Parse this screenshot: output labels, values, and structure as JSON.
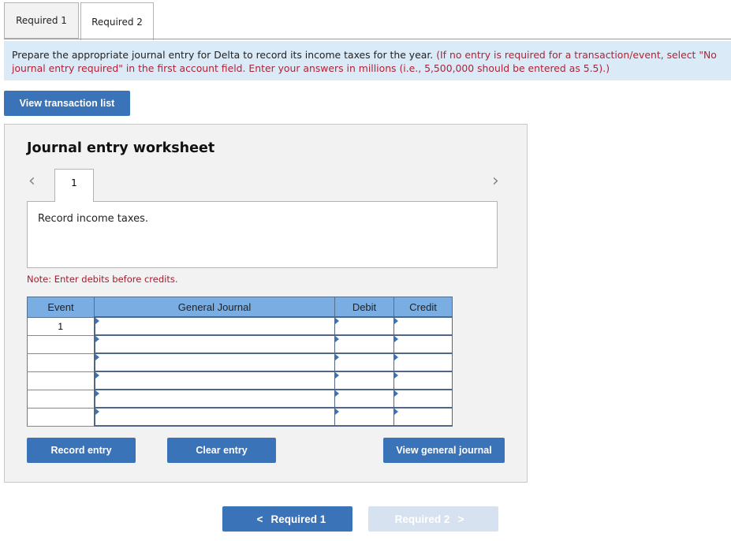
{
  "tabs": [
    {
      "label": "Required 1",
      "active": false
    },
    {
      "label": "Required 2",
      "active": true
    }
  ],
  "instructions": {
    "main": "Prepare the appropriate journal entry for Delta to record its income taxes for the year.",
    "note": "(If no entry is required for a transaction/event, select \"No journal entry required\" in the first account field. Enter your answers in millions (i.e., 5,500,000 should be entered as 5.5).)"
  },
  "buttons": {
    "view_transaction_list": "View transaction list",
    "record_entry": "Record entry",
    "clear_entry": "Clear entry",
    "view_general_journal": "View general journal"
  },
  "worksheet": {
    "title": "Journal entry worksheet",
    "prev_icon": "‹",
    "next_icon": "›",
    "entry_tab": "1",
    "description": "Record income taxes.",
    "note": "Note: Enter debits before credits."
  },
  "journal": {
    "headers": [
      "Event",
      "General Journal",
      "Debit",
      "Credit"
    ],
    "rows": [
      {
        "event": "1",
        "account": "",
        "debit": "",
        "credit": ""
      },
      {
        "event": "",
        "account": "",
        "debit": "",
        "credit": ""
      },
      {
        "event": "",
        "account": "",
        "debit": "",
        "credit": ""
      },
      {
        "event": "",
        "account": "",
        "debit": "",
        "credit": ""
      },
      {
        "event": "",
        "account": "",
        "debit": "",
        "credit": ""
      },
      {
        "event": "",
        "account": "",
        "debit": "",
        "credit": ""
      }
    ]
  },
  "nav": {
    "prev_label": "Required 1",
    "prev_icon": "<",
    "next_label": "Required 2",
    "next_icon": ">",
    "next_disabled": true
  },
  "colors": {
    "primary_button": "#3b73b9",
    "header_blue": "#7aaee3",
    "instruction_bg": "#dbeaf7",
    "note_red": "#a31c2c",
    "disabled_button": "#d7e2f0"
  }
}
